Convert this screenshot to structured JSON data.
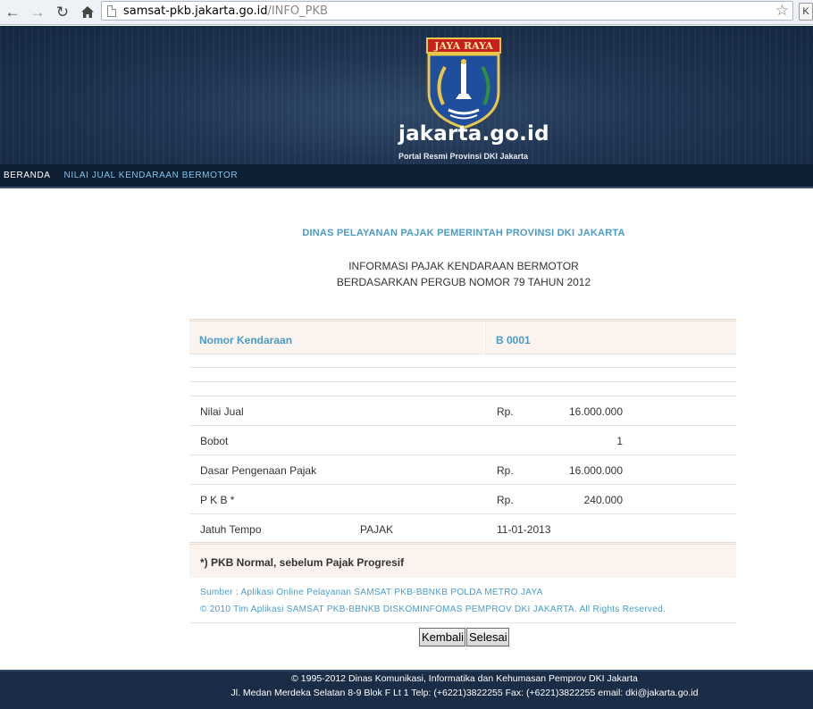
{
  "browser": {
    "url_host": "samsat-pkb.jakarta.go.id",
    "url_path": "/INFO_PKB",
    "extension_label": "K"
  },
  "header": {
    "crest_banner": "JAYA RAYA",
    "site_name": "jakarta.go.id",
    "tagline": "Portal Resmi Provinsi DKI Jakarta"
  },
  "menu": {
    "home": "BERANDA",
    "current": "NILAI JUAL KENDARAAN BERMOTOR"
  },
  "content": {
    "department": "DINAS PELAYANAN PAJAK PEMERINTAH PROVINSI DKI JAKARTA",
    "info_line1": "INFORMASI PAJAK KENDARAAN BERMOTOR",
    "info_line2": "BERDASARKAN PERGUB NOMOR 79 TAHUN 2012"
  },
  "table": {
    "header_label": "Nomor Kendaraan",
    "header_value": "B 0001",
    "rows": [
      {
        "label": "Nilai Jual",
        "mid": "",
        "currency": "Rp.",
        "amount": "16.000.000"
      },
      {
        "label": "Bobot",
        "mid": "",
        "currency": "",
        "amount": "1"
      },
      {
        "label": "Dasar Pengenaan Pajak",
        "mid": "",
        "currency": "Rp.",
        "amount": "16.000.000"
      },
      {
        "label": "P K B *",
        "mid": "",
        "currency": "Rp.",
        "amount": "240.000"
      },
      {
        "label": "Jatuh Tempo",
        "mid": "PAJAK",
        "currency": "11-01-2013",
        "amount": ""
      }
    ],
    "note": "*) PKB Normal, sebelum Pajak Progresif",
    "source": "Sumber : Aplikasi Online Pelayanan SAMSAT PKB-BBNKB POLDA METRO JAYA",
    "copyright": "© 2010 Tim Aplikasi SAMSAT PKB-BBNKB DISKOMINFOMAS PEMPROV DKI JAKARTA. All Rights Reserved."
  },
  "buttons": {
    "back": "Kembali",
    "done": "Selesai"
  },
  "footer": {
    "line1": "© 1995-2012 Dinas Komunikasi, Informatika dan Kehumasan Pemprov DKI Jakarta",
    "line2": "Jl. Medan Merdeka Selatan 8-9 Blok F Lt 1 Telp: (+6221)3822255 Fax: (+6221)3822255 email: dki@jakarta.go.id"
  },
  "colors": {
    "accent_blue": "#4a9cc9",
    "header_navy": "#1f3452",
    "row_highlight": "#fbf4ee"
  }
}
